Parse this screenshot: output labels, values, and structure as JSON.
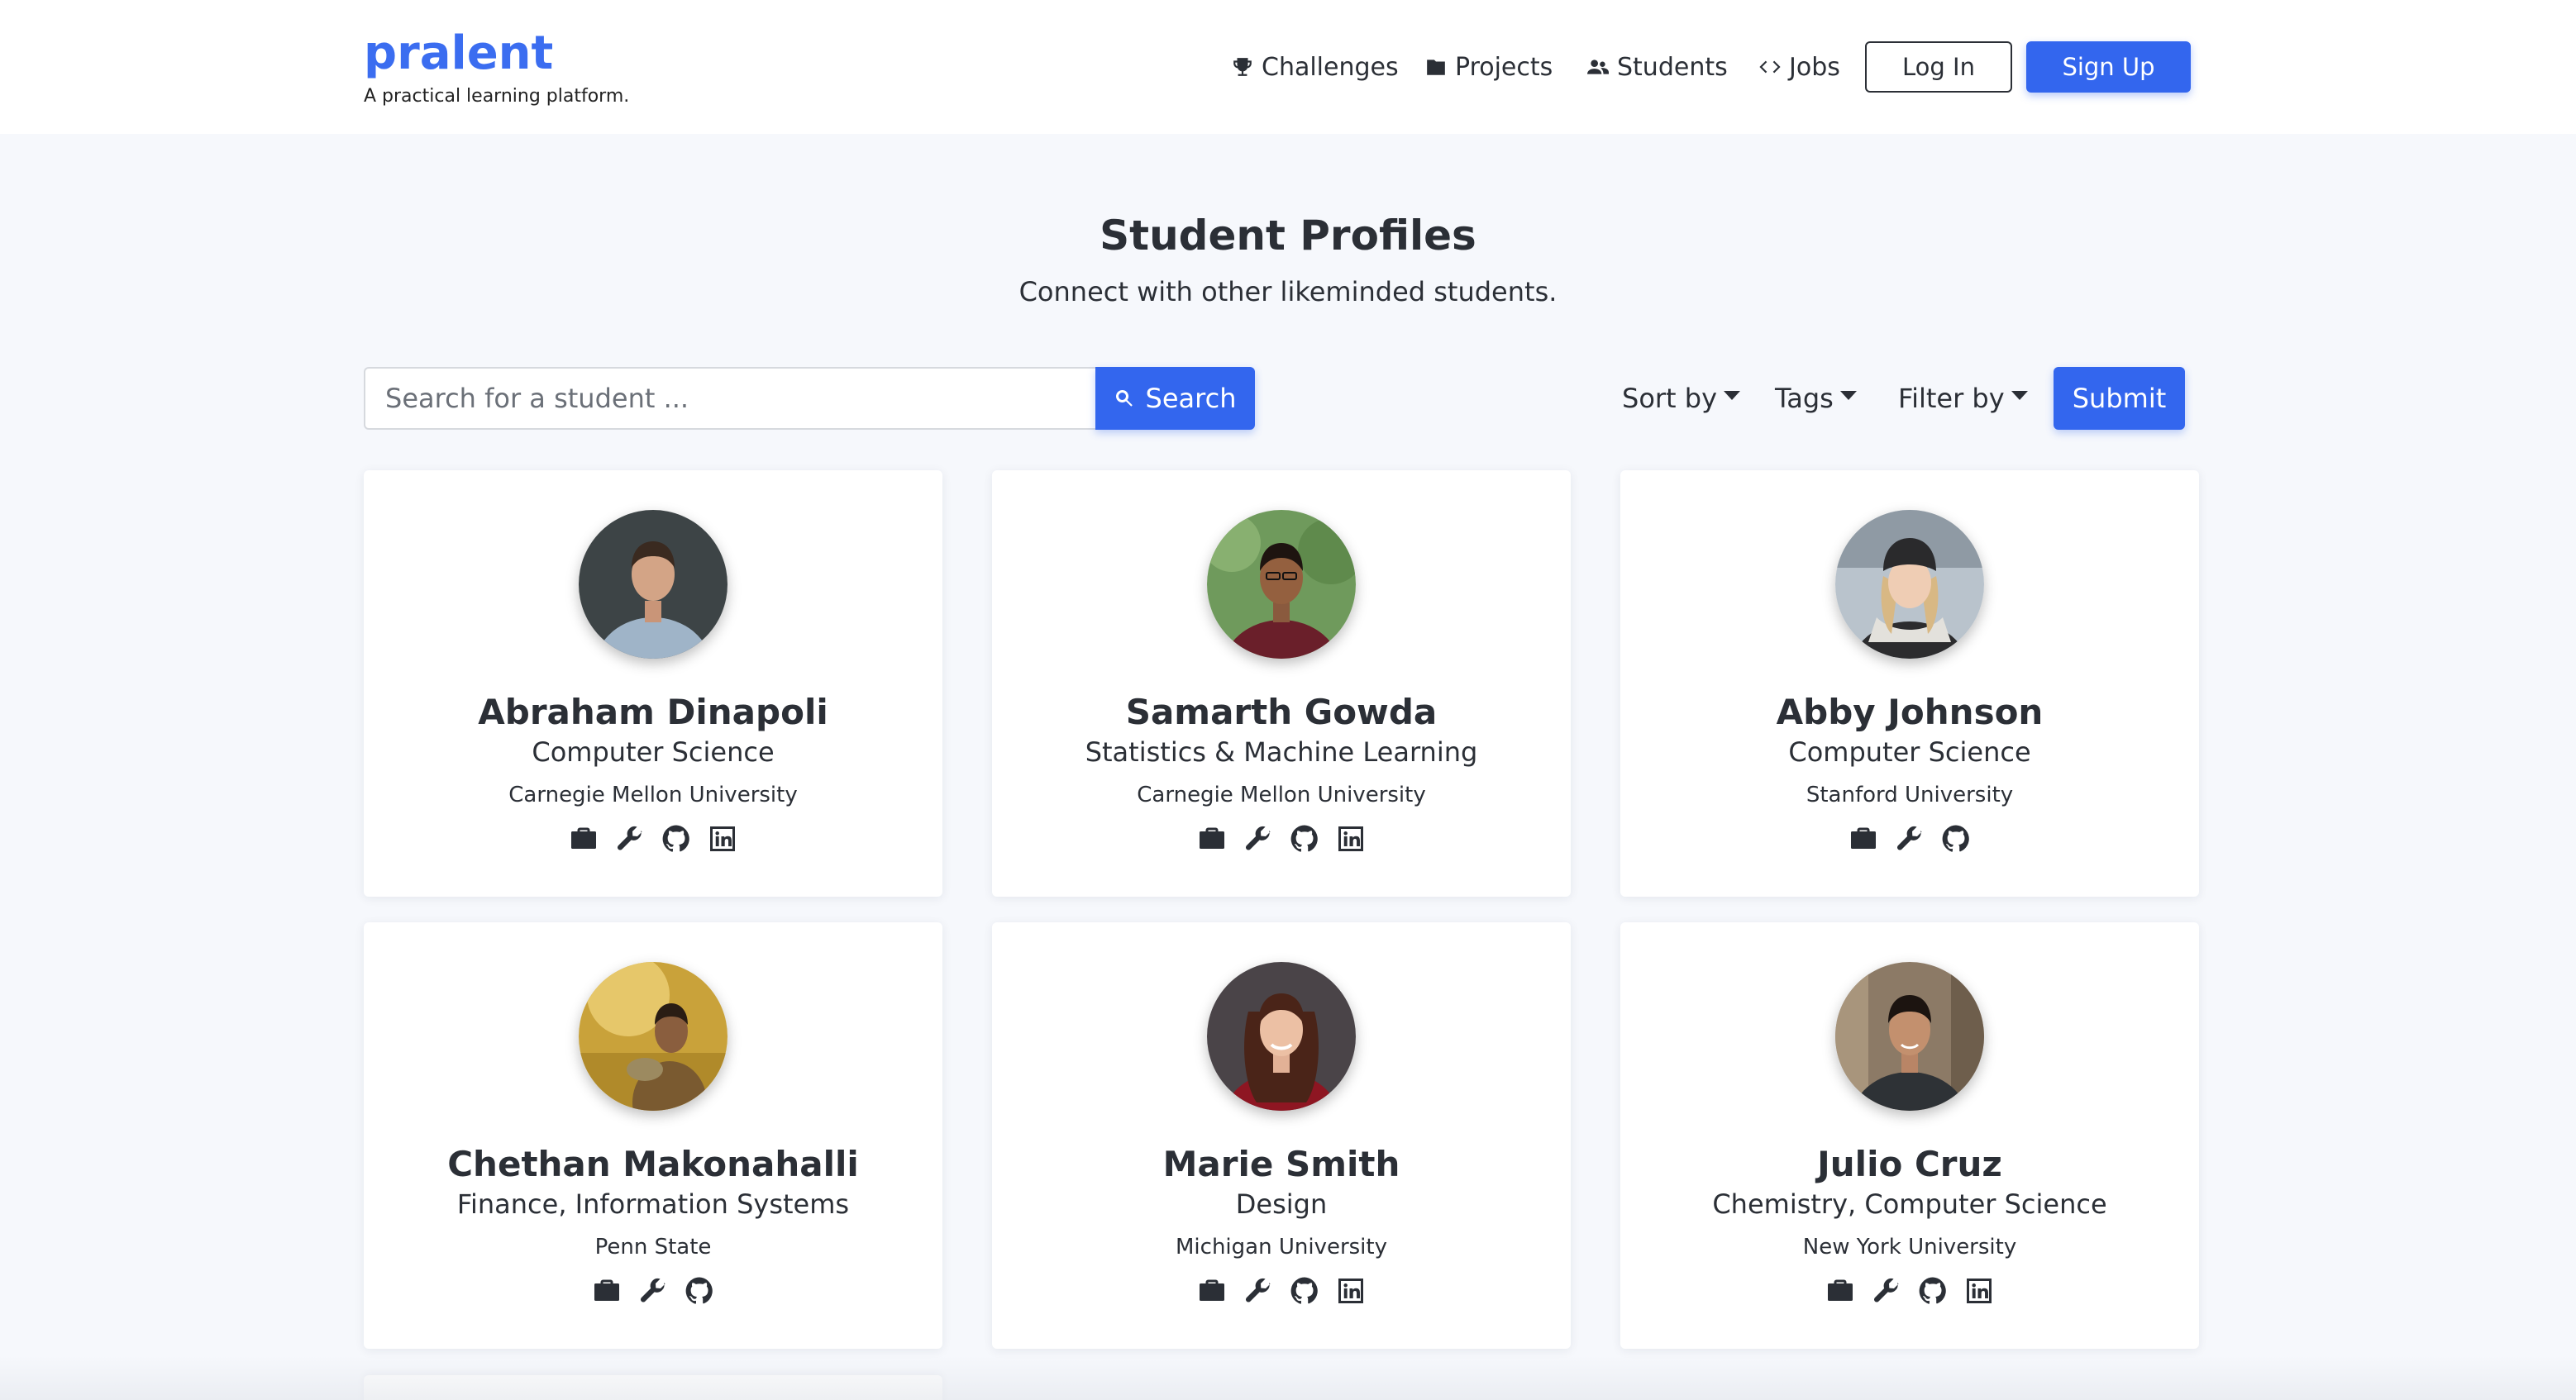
{
  "brand": {
    "name": "pralent",
    "tagline": "A practical learning platform."
  },
  "nav": {
    "challenges": "Challenges",
    "projects": "Projects",
    "students": "Students",
    "jobs": "Jobs",
    "login": "Log In",
    "signup": "Sign Up"
  },
  "hero": {
    "title": "Student Profiles",
    "subtitle": "Connect with other likeminded students."
  },
  "search": {
    "placeholder": "Search for a student ...",
    "button": "Search",
    "sort_by": "Sort by",
    "tags": "Tags",
    "filter_by": "Filter by",
    "submit": "Submit"
  },
  "colors": {
    "accent": "#3366ee",
    "brand": "#3b6df0",
    "background": "#f6f8fc",
    "text": "#2b2f36"
  },
  "students": [
    {
      "name": "Abraham Dinapoli",
      "major": "Computer Science",
      "school": "Carnegie Mellon University",
      "icons": [
        "briefcase-icon",
        "wrench-icon",
        "github-icon",
        "linkedin-icon"
      ]
    },
    {
      "name": "Samarth Gowda",
      "major": "Statistics & Machine Learning",
      "school": "Carnegie Mellon University",
      "icons": [
        "briefcase-icon",
        "wrench-icon",
        "github-icon",
        "linkedin-icon"
      ]
    },
    {
      "name": "Abby Johnson",
      "major": "Computer Science",
      "school": "Stanford University",
      "icons": [
        "briefcase-icon",
        "wrench-icon",
        "github-icon"
      ]
    },
    {
      "name": "Chethan Makonahalli",
      "major": "Finance, Information Systems",
      "school": "Penn State",
      "icons": [
        "briefcase-icon",
        "wrench-icon",
        "github-icon"
      ]
    },
    {
      "name": "Marie Smith",
      "major": "Design",
      "school": "Michigan University",
      "icons": [
        "briefcase-icon",
        "wrench-icon",
        "github-icon",
        "linkedin-icon"
      ]
    },
    {
      "name": "Julio Cruz",
      "major": "Chemistry, Computer Science",
      "school": "New York University",
      "icons": [
        "briefcase-icon",
        "wrench-icon",
        "github-icon",
        "linkedin-icon"
      ]
    }
  ]
}
